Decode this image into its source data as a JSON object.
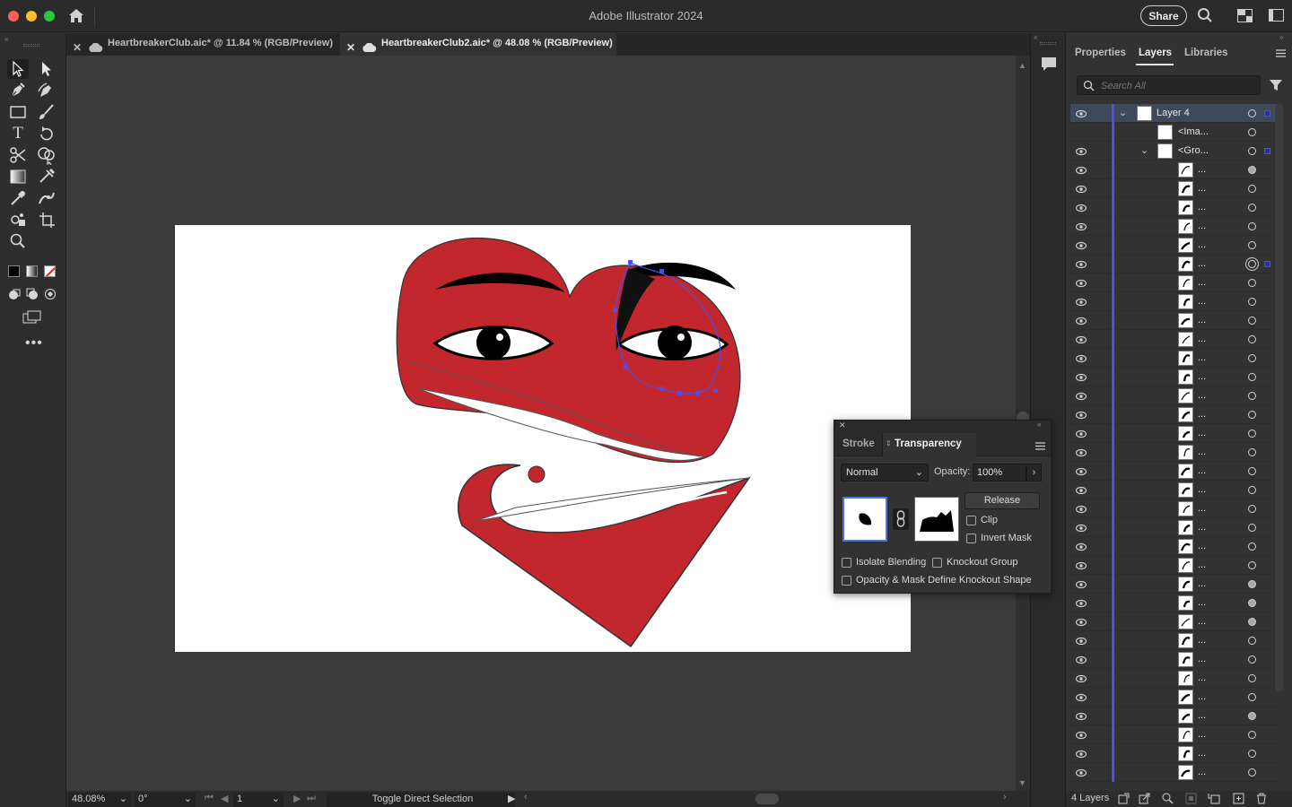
{
  "app": {
    "title": "Adobe Illustrator 2024",
    "share_label": "Share"
  },
  "tabs": [
    {
      "label": "HeartbreakerClub.aic* @ 11.84 % (RGB/Preview)",
      "active": false
    },
    {
      "label": "HeartbreakerClub2.aic* @ 48.08 % (RGB/Preview)",
      "active": true
    }
  ],
  "status": {
    "zoom": "48.08%",
    "rotation": "0°",
    "artboard": "1",
    "tool_hint": "Toggle Direct Selection"
  },
  "right_panel": {
    "tabs": [
      "Properties",
      "Layers",
      "Libraries"
    ],
    "active_tab": "Layers",
    "search_placeholder": "Search All",
    "footer_count": "4 Layers"
  },
  "layers": {
    "top": [
      {
        "name": "Layer 4",
        "expanded": true,
        "selected": true,
        "eye": true
      },
      {
        "name": "<Ima...",
        "indent": 1,
        "eye": false
      },
      {
        "name": "<Gro...",
        "indent": 1,
        "expanded": true,
        "eye": true
      }
    ],
    "child_label": "...",
    "child_count": 33,
    "filled_targets": [
      0,
      22,
      23,
      24,
      29
    ],
    "double_target": 5
  },
  "transparency": {
    "tabs": [
      "Stroke",
      "Transparency"
    ],
    "active_tab": "Transparency",
    "blend_mode": "Normal",
    "opacity_label": "Opacity:",
    "opacity": "100%",
    "release_label": "Release",
    "clip_label": "Clip",
    "invert_mask_label": "Invert Mask",
    "isolate_label": "Isolate Blending",
    "knockout_label": "Knockout Group",
    "opacity_mask_label": "Opacity & Mask Define Knockout Shape"
  },
  "colors": {
    "accent": "#4b4ef0",
    "heart_red": "#c1272d",
    "panel_bg": "#323232",
    "canvas_bg": "#3b3b3b"
  }
}
